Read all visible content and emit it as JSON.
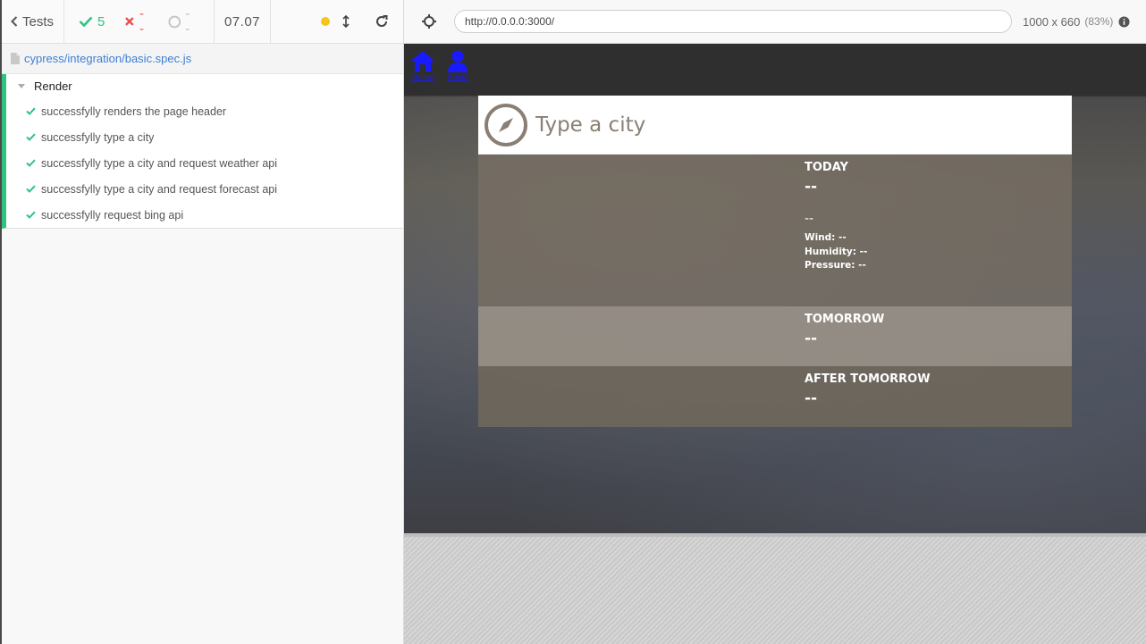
{
  "reporter": {
    "tests_label": "Tests",
    "passed": "5",
    "failed": "--",
    "pending": "--",
    "duration": "07.07",
    "spec_path": "cypress/integration/basic.spec.js",
    "suite_title": "Render",
    "tests": [
      "successfylly renders the page header",
      "successfylly type a city",
      "successfylly type a city and request weather api",
      "successfylly type a city and request forecast api",
      "successfylly request bing api"
    ]
  },
  "aut": {
    "url": "http://0.0.0.0:3000/",
    "viewport": "1000 x 660",
    "scale": "(83%)",
    "nav": {
      "home": "Home",
      "about": "About"
    },
    "search_placeholder": "Type a city",
    "today": {
      "title": "TODAY",
      "temp": "--",
      "desc": "--",
      "wind": "Wind: --",
      "humidity": "Humidity: --",
      "pressure": "Pressure: --"
    },
    "tomorrow": {
      "title": "TOMORROW",
      "temp": "--"
    },
    "after_tomorrow": {
      "title": "AFTER TOMORROW",
      "temp": "--"
    }
  },
  "colors": {
    "pass": "#2ec480",
    "fail": "#e94f4f",
    "link": "#3d7fd6",
    "running": "#f5c518"
  }
}
